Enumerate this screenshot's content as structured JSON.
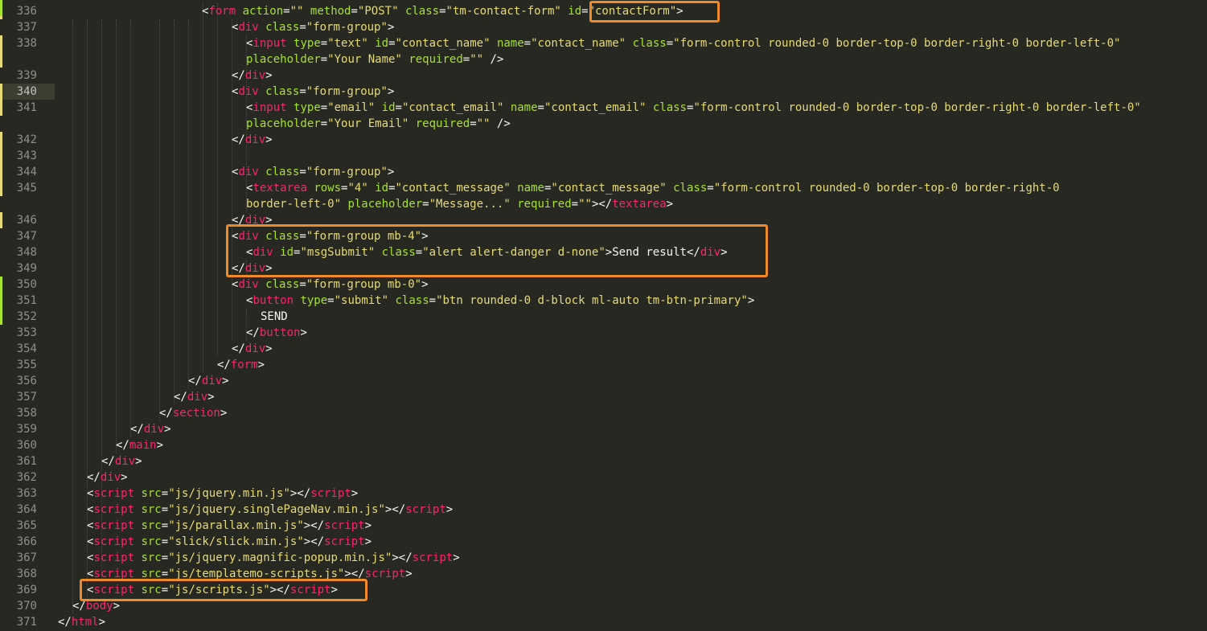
{
  "editor": {
    "language": "html",
    "theme": "monokai",
    "active_line": 340,
    "colors": {
      "background": "#272822",
      "tag": "#f92672",
      "attribute": "#a6e22e",
      "string": "#e6db74",
      "text": "#f8f8f2",
      "gutter_text": "#8f908a",
      "highlight_box": "#f08a24"
    },
    "line_numbers": [
      "336",
      "337",
      "338",
      "339",
      "340",
      "341",
      "342",
      "343",
      "344",
      "345",
      "346",
      "347",
      "348",
      "349",
      "350",
      "351",
      "352",
      "353",
      "354",
      "355",
      "356",
      "357",
      "358",
      "359",
      "360",
      "361",
      "362",
      "363",
      "364",
      "365",
      "366",
      "367",
      "368",
      "369",
      "370",
      "371"
    ],
    "lines": [
      [
        {
          "t": "<",
          "c": "pn"
        },
        {
          "t": "form",
          "c": "tag"
        },
        {
          "t": " ",
          "c": "tx"
        },
        {
          "t": "action",
          "c": "att"
        },
        {
          "t": "=",
          "c": "pn"
        },
        {
          "t": "\"\"",
          "c": "str"
        },
        {
          "t": " ",
          "c": "tx"
        },
        {
          "t": "method",
          "c": "att"
        },
        {
          "t": "=",
          "c": "pn"
        },
        {
          "t": "\"POST\"",
          "c": "str"
        },
        {
          "t": " ",
          "c": "tx"
        },
        {
          "t": "class",
          "c": "att"
        },
        {
          "t": "=",
          "c": "pn"
        },
        {
          "t": "\"tm-contact-form\"",
          "c": "str"
        },
        {
          "t": " ",
          "c": "tx"
        },
        {
          "t": "id",
          "c": "att"
        },
        {
          "t": "=",
          "c": "pn"
        },
        {
          "t": "\"contactForm\"",
          "c": "str"
        },
        {
          "t": ">",
          "c": "pn"
        }
      ],
      [
        {
          "t": "<",
          "c": "pn"
        },
        {
          "t": "div",
          "c": "tag"
        },
        {
          "t": " ",
          "c": "tx"
        },
        {
          "t": "class",
          "c": "att"
        },
        {
          "t": "=",
          "c": "pn"
        },
        {
          "t": "\"form-group\"",
          "c": "str"
        },
        {
          "t": ">",
          "c": "pn"
        }
      ],
      [
        {
          "t": "<",
          "c": "pn"
        },
        {
          "t": "input",
          "c": "tag"
        },
        {
          "t": " ",
          "c": "tx"
        },
        {
          "t": "type",
          "c": "att"
        },
        {
          "t": "=",
          "c": "pn"
        },
        {
          "t": "\"text\"",
          "c": "str"
        },
        {
          "t": " ",
          "c": "tx"
        },
        {
          "t": "id",
          "c": "att"
        },
        {
          "t": "=",
          "c": "pn"
        },
        {
          "t": "\"contact_name\"",
          "c": "str"
        },
        {
          "t": " ",
          "c": "tx"
        },
        {
          "t": "name",
          "c": "att"
        },
        {
          "t": "=",
          "c": "pn"
        },
        {
          "t": "\"contact_name\"",
          "c": "str"
        },
        {
          "t": " ",
          "c": "tx"
        },
        {
          "t": "class",
          "c": "att"
        },
        {
          "t": "=",
          "c": "pn"
        },
        {
          "t": "\"form-control rounded-0 border-top-0 border-right-0 border-left-0\"",
          "c": "str"
        }
      ],
      [
        {
          "t": "placeholder",
          "c": "att"
        },
        {
          "t": "=",
          "c": "pn"
        },
        {
          "t": "\"Your Name\"",
          "c": "str"
        },
        {
          "t": " ",
          "c": "tx"
        },
        {
          "t": "required",
          "c": "att"
        },
        {
          "t": "=",
          "c": "pn"
        },
        {
          "t": "\"\"",
          "c": "str"
        },
        {
          "t": " />",
          "c": "pn"
        }
      ],
      [
        {
          "t": "</",
          "c": "pn"
        },
        {
          "t": "div",
          "c": "tag"
        },
        {
          "t": ">",
          "c": "pn"
        }
      ],
      [
        {
          "t": "<",
          "c": "pn"
        },
        {
          "t": "div",
          "c": "tag"
        },
        {
          "t": " ",
          "c": "tx"
        },
        {
          "t": "class",
          "c": "att"
        },
        {
          "t": "=",
          "c": "pn"
        },
        {
          "t": "\"form-group\"",
          "c": "str"
        },
        {
          "t": ">",
          "c": "pn"
        }
      ],
      [
        {
          "t": "<",
          "c": "pn"
        },
        {
          "t": "input",
          "c": "tag"
        },
        {
          "t": " ",
          "c": "tx"
        },
        {
          "t": "type",
          "c": "att"
        },
        {
          "t": "=",
          "c": "pn"
        },
        {
          "t": "\"email\"",
          "c": "str"
        },
        {
          "t": " ",
          "c": "tx"
        },
        {
          "t": "id",
          "c": "att"
        },
        {
          "t": "=",
          "c": "pn"
        },
        {
          "t": "\"contact_email\"",
          "c": "str"
        },
        {
          "t": " ",
          "c": "tx"
        },
        {
          "t": "name",
          "c": "att"
        },
        {
          "t": "=",
          "c": "pn"
        },
        {
          "t": "\"contact_email\"",
          "c": "str"
        },
        {
          "t": " ",
          "c": "tx"
        },
        {
          "t": "class",
          "c": "att"
        },
        {
          "t": "=",
          "c": "pn"
        },
        {
          "t": "\"form-control rounded-0 border-top-0 border-right-0 border-left-0\"",
          "c": "str"
        }
      ],
      [
        {
          "t": "placeholder",
          "c": "att"
        },
        {
          "t": "=",
          "c": "pn"
        },
        {
          "t": "\"Your Email\"",
          "c": "str"
        },
        {
          "t": " ",
          "c": "tx"
        },
        {
          "t": "required",
          "c": "att"
        },
        {
          "t": "=",
          "c": "pn"
        },
        {
          "t": "\"\"",
          "c": "str"
        },
        {
          "t": " />",
          "c": "pn"
        }
      ],
      [
        {
          "t": "</",
          "c": "pn"
        },
        {
          "t": "div",
          "c": "tag"
        },
        {
          "t": ">",
          "c": "pn"
        }
      ],
      [],
      [
        {
          "t": "<",
          "c": "pn"
        },
        {
          "t": "div",
          "c": "tag"
        },
        {
          "t": " ",
          "c": "tx"
        },
        {
          "t": "class",
          "c": "att"
        },
        {
          "t": "=",
          "c": "pn"
        },
        {
          "t": "\"form-group\"",
          "c": "str"
        },
        {
          "t": ">",
          "c": "pn"
        }
      ],
      [
        {
          "t": "<",
          "c": "pn"
        },
        {
          "t": "textarea",
          "c": "tag"
        },
        {
          "t": " ",
          "c": "tx"
        },
        {
          "t": "rows",
          "c": "att"
        },
        {
          "t": "=",
          "c": "pn"
        },
        {
          "t": "\"4\"",
          "c": "str"
        },
        {
          "t": " ",
          "c": "tx"
        },
        {
          "t": "id",
          "c": "att"
        },
        {
          "t": "=",
          "c": "pn"
        },
        {
          "t": "\"contact_message\"",
          "c": "str"
        },
        {
          "t": " ",
          "c": "tx"
        },
        {
          "t": "name",
          "c": "att"
        },
        {
          "t": "=",
          "c": "pn"
        },
        {
          "t": "\"contact_message\"",
          "c": "str"
        },
        {
          "t": " ",
          "c": "tx"
        },
        {
          "t": "class",
          "c": "att"
        },
        {
          "t": "=",
          "c": "pn"
        },
        {
          "t": "\"form-control rounded-0 border-top-0 border-right-0",
          "c": "str"
        }
      ],
      [
        {
          "t": "border-left-0\"",
          "c": "str"
        },
        {
          "t": " ",
          "c": "tx"
        },
        {
          "t": "placeholder",
          "c": "att"
        },
        {
          "t": "=",
          "c": "pn"
        },
        {
          "t": "\"Message...\"",
          "c": "str"
        },
        {
          "t": " ",
          "c": "tx"
        },
        {
          "t": "required",
          "c": "att"
        },
        {
          "t": "=",
          "c": "pn"
        },
        {
          "t": "\"\"",
          "c": "str"
        },
        {
          "t": "></",
          "c": "pn"
        },
        {
          "t": "textarea",
          "c": "tag"
        },
        {
          "t": ">",
          "c": "pn"
        }
      ],
      [
        {
          "t": "</",
          "c": "pn"
        },
        {
          "t": "div",
          "c": "tag"
        },
        {
          "t": ">",
          "c": "pn"
        }
      ],
      [
        {
          "t": "<",
          "c": "pn"
        },
        {
          "t": "div",
          "c": "tag"
        },
        {
          "t": " ",
          "c": "tx"
        },
        {
          "t": "class",
          "c": "att"
        },
        {
          "t": "=",
          "c": "pn"
        },
        {
          "t": "\"form-group mb-4\"",
          "c": "str"
        },
        {
          "t": ">",
          "c": "pn"
        }
      ],
      [
        {
          "t": "<",
          "c": "pn"
        },
        {
          "t": "div",
          "c": "tag"
        },
        {
          "t": " ",
          "c": "tx"
        },
        {
          "t": "id",
          "c": "att"
        },
        {
          "t": "=",
          "c": "pn"
        },
        {
          "t": "\"msgSubmit\"",
          "c": "str"
        },
        {
          "t": " ",
          "c": "tx"
        },
        {
          "t": "class",
          "c": "att"
        },
        {
          "t": "=",
          "c": "pn"
        },
        {
          "t": "\"alert alert-danger d-none\"",
          "c": "str"
        },
        {
          "t": ">Send result</",
          "c": "pn"
        },
        {
          "t": "div",
          "c": "tag"
        },
        {
          "t": ">",
          "c": "pn"
        }
      ],
      [
        {
          "t": "</",
          "c": "pn"
        },
        {
          "t": "div",
          "c": "tag"
        },
        {
          "t": ">",
          "c": "pn"
        }
      ],
      [
        {
          "t": "<",
          "c": "pn"
        },
        {
          "t": "div",
          "c": "tag"
        },
        {
          "t": " ",
          "c": "tx"
        },
        {
          "t": "class",
          "c": "att"
        },
        {
          "t": "=",
          "c": "pn"
        },
        {
          "t": "\"form-group mb-0\"",
          "c": "str"
        },
        {
          "t": ">",
          "c": "pn"
        }
      ],
      [
        {
          "t": "<",
          "c": "pn"
        },
        {
          "t": "button",
          "c": "tag"
        },
        {
          "t": " ",
          "c": "tx"
        },
        {
          "t": "type",
          "c": "att"
        },
        {
          "t": "=",
          "c": "pn"
        },
        {
          "t": "\"submit\"",
          "c": "str"
        },
        {
          "t": " ",
          "c": "tx"
        },
        {
          "t": "class",
          "c": "att"
        },
        {
          "t": "=",
          "c": "pn"
        },
        {
          "t": "\"btn rounded-0 d-block ml-auto tm-btn-primary\"",
          "c": "str"
        },
        {
          "t": ">",
          "c": "pn"
        }
      ],
      [
        {
          "t": "SEND",
          "c": "tx"
        }
      ],
      [
        {
          "t": "</",
          "c": "pn"
        },
        {
          "t": "button",
          "c": "tag"
        },
        {
          "t": ">",
          "c": "pn"
        }
      ],
      [
        {
          "t": "</",
          "c": "pn"
        },
        {
          "t": "div",
          "c": "tag"
        },
        {
          "t": ">",
          "c": "pn"
        }
      ],
      [
        {
          "t": "</",
          "c": "pn"
        },
        {
          "t": "form",
          "c": "tag"
        },
        {
          "t": ">",
          "c": "pn"
        }
      ],
      [
        {
          "t": "</",
          "c": "pn"
        },
        {
          "t": "div",
          "c": "tag"
        },
        {
          "t": ">",
          "c": "pn"
        }
      ],
      [
        {
          "t": "</",
          "c": "pn"
        },
        {
          "t": "div",
          "c": "tag"
        },
        {
          "t": ">",
          "c": "pn"
        }
      ],
      [
        {
          "t": "</",
          "c": "pn"
        },
        {
          "t": "section",
          "c": "tag"
        },
        {
          "t": ">",
          "c": "pn"
        }
      ],
      [
        {
          "t": "</",
          "c": "pn"
        },
        {
          "t": "div",
          "c": "tag"
        },
        {
          "t": ">",
          "c": "pn"
        }
      ],
      [
        {
          "t": "</",
          "c": "pn"
        },
        {
          "t": "main",
          "c": "tag"
        },
        {
          "t": ">",
          "c": "pn"
        }
      ],
      [
        {
          "t": "</",
          "c": "pn"
        },
        {
          "t": "div",
          "c": "tag"
        },
        {
          "t": ">",
          "c": "pn"
        }
      ],
      [
        {
          "t": "</",
          "c": "pn"
        },
        {
          "t": "div",
          "c": "tag"
        },
        {
          "t": ">",
          "c": "pn"
        }
      ],
      [
        {
          "t": "<",
          "c": "pn"
        },
        {
          "t": "script",
          "c": "tag"
        },
        {
          "t": " ",
          "c": "tx"
        },
        {
          "t": "src",
          "c": "att"
        },
        {
          "t": "=",
          "c": "pn"
        },
        {
          "t": "\"js/jquery.min.js\"",
          "c": "str"
        },
        {
          "t": "></",
          "c": "pn"
        },
        {
          "t": "script",
          "c": "tag"
        },
        {
          "t": ">",
          "c": "pn"
        }
      ],
      [
        {
          "t": "<",
          "c": "pn"
        },
        {
          "t": "script",
          "c": "tag"
        },
        {
          "t": " ",
          "c": "tx"
        },
        {
          "t": "src",
          "c": "att"
        },
        {
          "t": "=",
          "c": "pn"
        },
        {
          "t": "\"js/jquery.singlePageNav.min.js\"",
          "c": "str"
        },
        {
          "t": "></",
          "c": "pn"
        },
        {
          "t": "script",
          "c": "tag"
        },
        {
          "t": ">",
          "c": "pn"
        }
      ],
      [
        {
          "t": "<",
          "c": "pn"
        },
        {
          "t": "script",
          "c": "tag"
        },
        {
          "t": " ",
          "c": "tx"
        },
        {
          "t": "src",
          "c": "att"
        },
        {
          "t": "=",
          "c": "pn"
        },
        {
          "t": "\"js/parallax.min.js\"",
          "c": "str"
        },
        {
          "t": "></",
          "c": "pn"
        },
        {
          "t": "script",
          "c": "tag"
        },
        {
          "t": ">",
          "c": "pn"
        }
      ],
      [
        {
          "t": "<",
          "c": "pn"
        },
        {
          "t": "script",
          "c": "tag"
        },
        {
          "t": " ",
          "c": "tx"
        },
        {
          "t": "src",
          "c": "att"
        },
        {
          "t": "=",
          "c": "pn"
        },
        {
          "t": "\"slick/slick.min.js\"",
          "c": "str"
        },
        {
          "t": "></",
          "c": "pn"
        },
        {
          "t": "script",
          "c": "tag"
        },
        {
          "t": ">",
          "c": "pn"
        }
      ],
      [
        {
          "t": "<",
          "c": "pn"
        },
        {
          "t": "script",
          "c": "tag"
        },
        {
          "t": " ",
          "c": "tx"
        },
        {
          "t": "src",
          "c": "att"
        },
        {
          "t": "=",
          "c": "pn"
        },
        {
          "t": "\"js/jquery.magnific-popup.min.js\"",
          "c": "str"
        },
        {
          "t": "></",
          "c": "pn"
        },
        {
          "t": "script",
          "c": "tag"
        },
        {
          "t": ">",
          "c": "pn"
        }
      ],
      [
        {
          "t": "<",
          "c": "pn"
        },
        {
          "t": "script",
          "c": "tag"
        },
        {
          "t": " ",
          "c": "tx"
        },
        {
          "t": "src",
          "c": "att"
        },
        {
          "t": "=",
          "c": "pn"
        },
        {
          "t": "\"js/templatemo-scripts.js\"",
          "c": "str"
        },
        {
          "t": "></",
          "c": "pn"
        },
        {
          "t": "script",
          "c": "tag"
        },
        {
          "t": ">",
          "c": "pn"
        }
      ],
      [
        {
          "t": "<",
          "c": "pn"
        },
        {
          "t": "script",
          "c": "tag"
        },
        {
          "t": " ",
          "c": "tx"
        },
        {
          "t": "src",
          "c": "att"
        },
        {
          "t": "=",
          "c": "pn"
        },
        {
          "t": "\"js/scripts.js\"",
          "c": "str"
        },
        {
          "t": "></",
          "c": "pn"
        },
        {
          "t": "script",
          "c": "tag"
        },
        {
          "t": ">",
          "c": "pn"
        }
      ],
      [
        {
          "t": "</",
          "c": "pn"
        },
        {
          "t": "body",
          "c": "tag"
        },
        {
          "t": ">",
          "c": "pn"
        }
      ],
      [
        {
          "t": "</",
          "c": "pn"
        },
        {
          "t": "html",
          "c": "tag"
        },
        {
          "t": ">",
          "c": "pn"
        }
      ]
    ]
  }
}
